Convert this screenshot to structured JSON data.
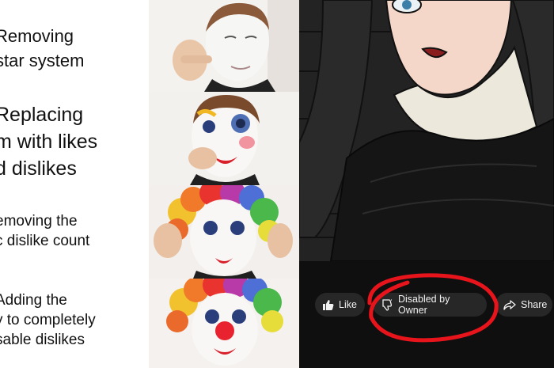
{
  "meme": {
    "captions": [
      "Removing\nstar system",
      "Replacing\nm with likes\nd dislikes",
      "emoving the\nc dislike count",
      "Adding the\ny to completely\nsable dislikes"
    ]
  },
  "video": {
    "actions": {
      "like_label": "Like",
      "dislike_label": "Disabled by Owner",
      "share_label": "Share"
    }
  },
  "colors": {
    "circle": "#e8141c",
    "nose": "#e8222f",
    "button_bg": "#272727"
  }
}
